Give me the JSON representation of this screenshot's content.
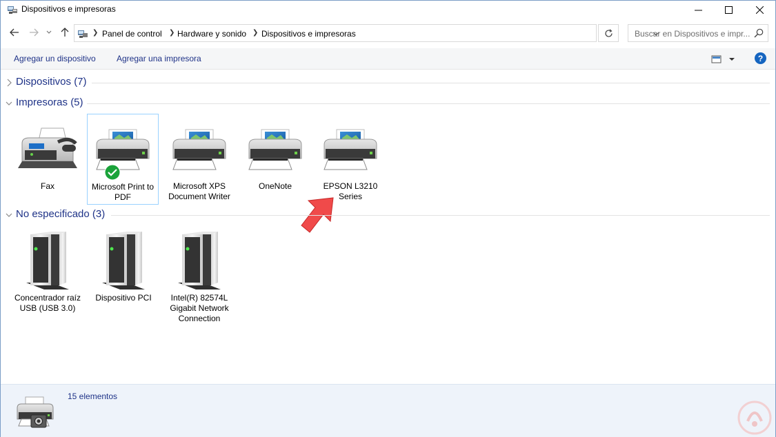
{
  "window": {
    "title": "Dispositivos e impresoras",
    "controls": {
      "minimize": "—",
      "maximize": "☐",
      "close": "✕"
    }
  },
  "address_bar": {
    "breadcrumbs": [
      "Panel de control",
      "Hardware y sonido",
      "Dispositivos e impresoras"
    ],
    "search_placeholder": "Buscar en Dispositivos e impr..."
  },
  "command_bar": {
    "add_device": "Agregar un dispositivo",
    "add_printer": "Agregar una impresora",
    "help": "?"
  },
  "groups": {
    "devices": {
      "label": "Dispositivos (7)",
      "expanded": false
    },
    "printers": {
      "label": "Impresoras (5)",
      "expanded": true,
      "items": [
        {
          "name": "Fax",
          "icon": "fax-icon"
        },
        {
          "name": "Microsoft Print to PDF",
          "icon": "printer-icon",
          "default": true,
          "selected": true
        },
        {
          "name": "Microsoft XPS Document Writer",
          "icon": "printer-icon"
        },
        {
          "name": "OneNote",
          "icon": "printer-icon"
        },
        {
          "name": "EPSON L3210 Series",
          "icon": "printer-icon"
        }
      ]
    },
    "unspecified": {
      "label": "No especificado (3)",
      "expanded": true,
      "items": [
        {
          "name": "Concentrador raíz USB (USB 3.0)",
          "icon": "computer-tower-icon"
        },
        {
          "name": "Dispositivo PCI",
          "icon": "computer-tower-icon"
        },
        {
          "name": "Intel(R) 82574L Gigabit Network Connection",
          "icon": "computer-tower-icon"
        }
      ]
    }
  },
  "details_pane": {
    "count_text": "15 elementos"
  },
  "colors": {
    "link": "#1e3287",
    "pointer_arrow": "#f04a4a",
    "check_badge": "#1aa33a"
  }
}
